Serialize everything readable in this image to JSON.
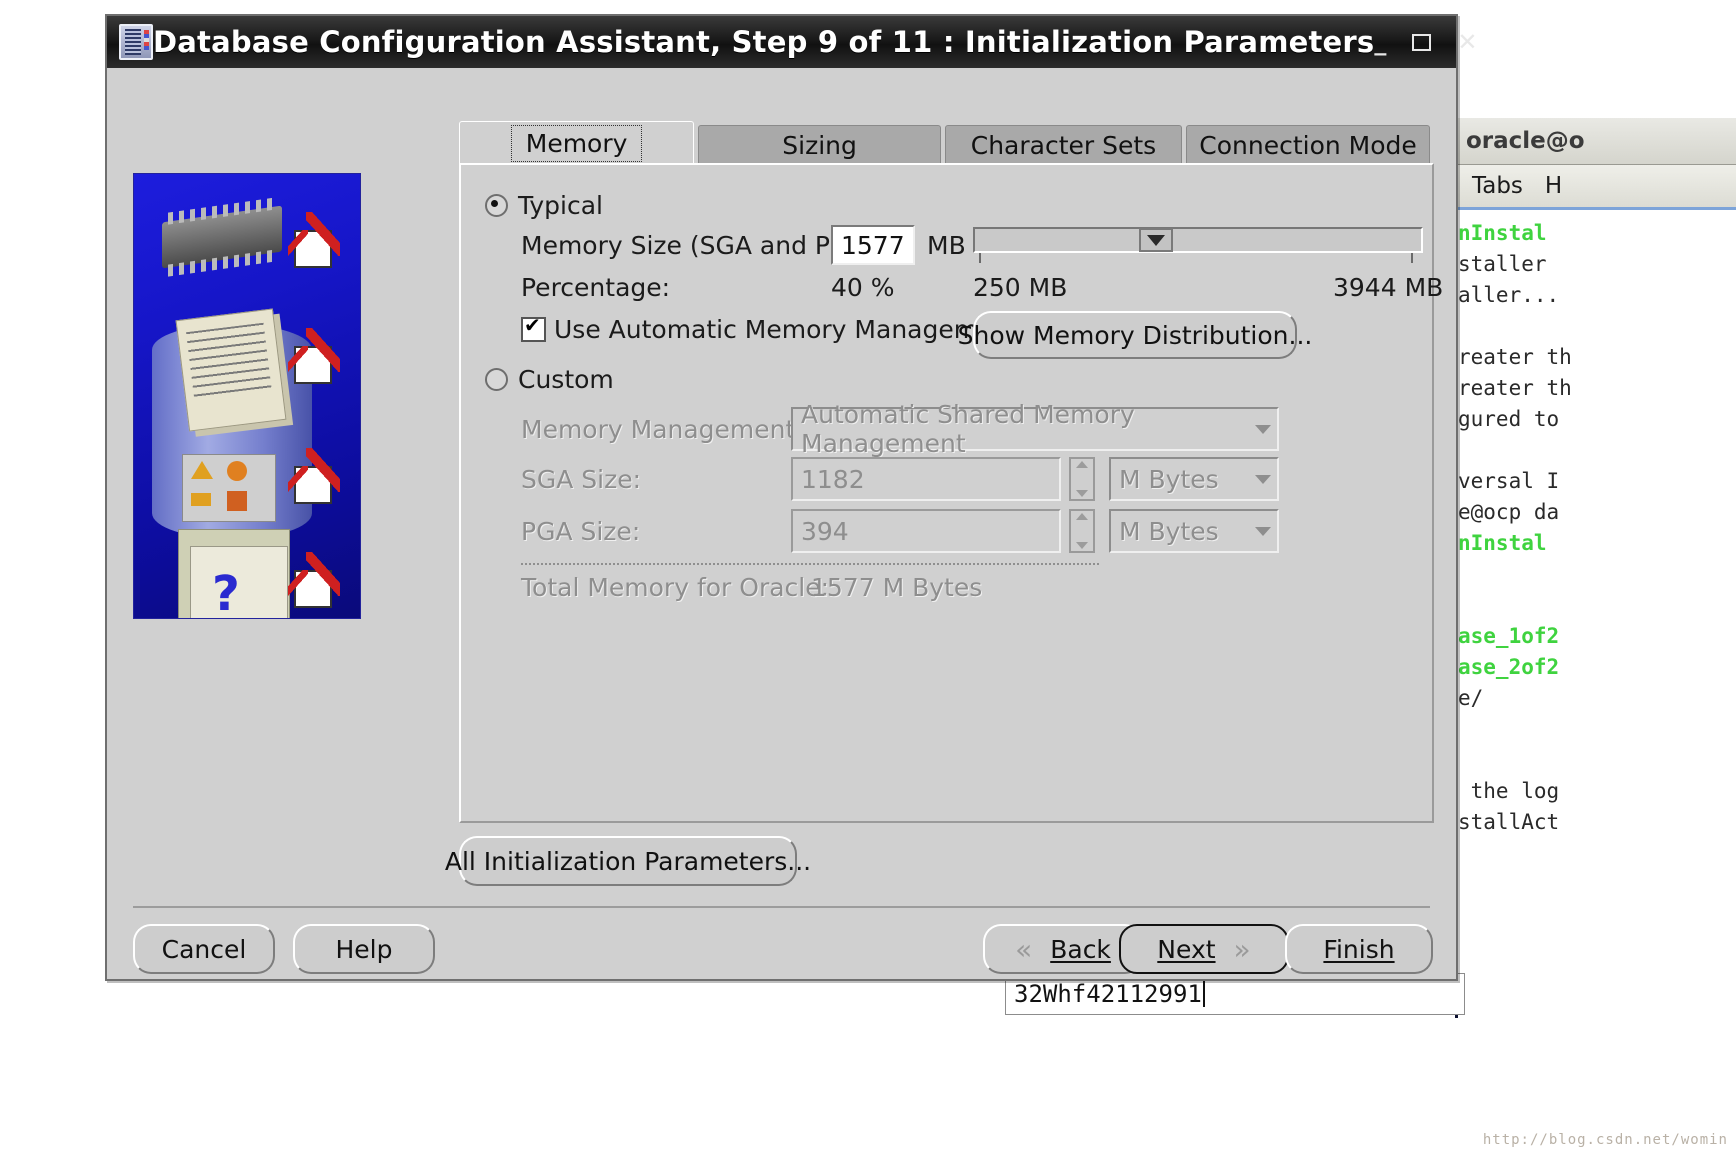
{
  "window": {
    "title": "Database Configuration Assistant, Step 9 of 11 : Initialization Parameters",
    "minimize": "_",
    "maximize": "",
    "close": "✕"
  },
  "tabs": [
    {
      "label": "Memory",
      "selected": true
    },
    {
      "label": "Sizing",
      "selected": false
    },
    {
      "label": "Character Sets",
      "selected": false
    },
    {
      "label": "Connection Mode",
      "selected": false
    }
  ],
  "typical": {
    "radio_label": "Typical",
    "selected": true,
    "memory_size_label": "Memory Size (SGA and PGA):",
    "memory_size_value": "1577",
    "memory_size_unit": "MB",
    "percentage_label": "Percentage:",
    "percentage_value": "40 %",
    "slider_min_label": "250 MB",
    "slider_max_label": "3944 MB",
    "slider_position_percent": 40,
    "amm_checkbox_label": "Use Automatic Memory Management",
    "amm_checked": true,
    "show_memory_distribution_label": "Show Memory Distribution..."
  },
  "custom": {
    "radio_label": "Custom",
    "selected": false,
    "memory_management_label": "Memory Management",
    "memory_management_value": "Automatic Shared Memory Management",
    "sga_label": "SGA Size:",
    "sga_value": "1182",
    "sga_unit": "M Bytes",
    "pga_label": "PGA Size:",
    "pga_value": "394",
    "pga_unit": "M Bytes",
    "total_label": "Total Memory for Oracle:",
    "total_value": "1577 M Bytes"
  },
  "buttons": {
    "all_init_params": "All Initialization Parameters...",
    "cancel": "Cancel",
    "help": "Help",
    "back": "Back",
    "next": "Next",
    "finish": "Finish"
  },
  "terminal": {
    "title": "oracle@o",
    "menu_tabs": "Tabs",
    "menu_help": "H",
    "lines": [
      {
        "text": "nInstal",
        "color": "green"
      },
      {
        "text": "staller",
        "color": "black"
      },
      {
        "text": "aller...",
        "color": "black"
      },
      {
        "text": "",
        "color": "black"
      },
      {
        "text": "reater th",
        "color": "black"
      },
      {
        "text": "reater th",
        "color": "black"
      },
      {
        "text": "gured to",
        "color": "black"
      },
      {
        "text": "",
        "color": "black"
      },
      {
        "text": "versal I",
        "color": "black"
      },
      {
        "text": "e@ocp da",
        "color": "black"
      },
      {
        "text": "nInstal",
        "color": "green"
      },
      {
        "text": "",
        "color": "black"
      },
      {
        "text": "",
        "color": "black"
      },
      {
        "text": "ase_1of2",
        "color": "green"
      },
      {
        "text": "ase_2of2",
        "color": "green"
      },
      {
        "text": "e/",
        "color": "black"
      },
      {
        "text": "",
        "color": "black"
      },
      {
        "text": "",
        "color": "black"
      },
      {
        "text": " the log",
        "color": "black"
      },
      {
        "text": "stallAct",
        "color": "black"
      }
    ],
    "input_value": "32Whf42112991"
  },
  "watermark": "http://blog.csdn.net/womin"
}
